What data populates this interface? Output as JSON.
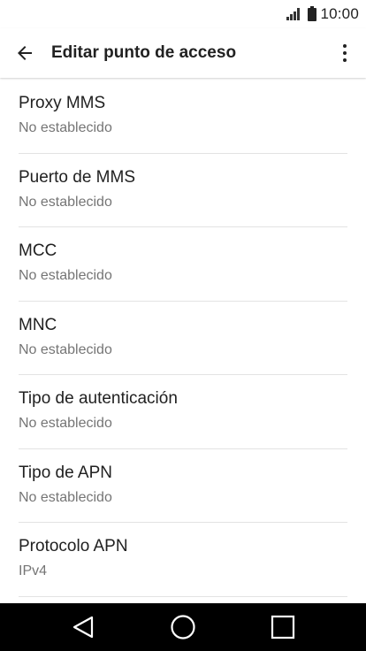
{
  "status_bar": {
    "time": "10:00",
    "signal_icon": "signal-icon",
    "battery_icon": "battery-icon"
  },
  "app_bar": {
    "title": "Editar punto de acceso",
    "back_icon": "arrow-back-icon",
    "menu_icon": "more-vert-icon"
  },
  "settings": [
    {
      "title": "Proxy MMS",
      "value": "No establecido"
    },
    {
      "title": "Puerto de MMS",
      "value": "No establecido"
    },
    {
      "title": "MCC",
      "value": "No establecido"
    },
    {
      "title": "MNC",
      "value": "No establecido"
    },
    {
      "title": "Tipo de autenticación",
      "value": "No establecido"
    },
    {
      "title": "Tipo de APN",
      "value": "No establecido"
    },
    {
      "title": "Protocolo APN",
      "value": "IPv4"
    }
  ],
  "nav_bar": {
    "back_icon": "nav-back-icon",
    "home_icon": "nav-home-icon",
    "recents_icon": "nav-recents-icon"
  },
  "colors": {
    "text_primary": "#212121",
    "text_secondary": "#757575",
    "divider": "#e3e3e3",
    "nav_bar": "#000000"
  }
}
